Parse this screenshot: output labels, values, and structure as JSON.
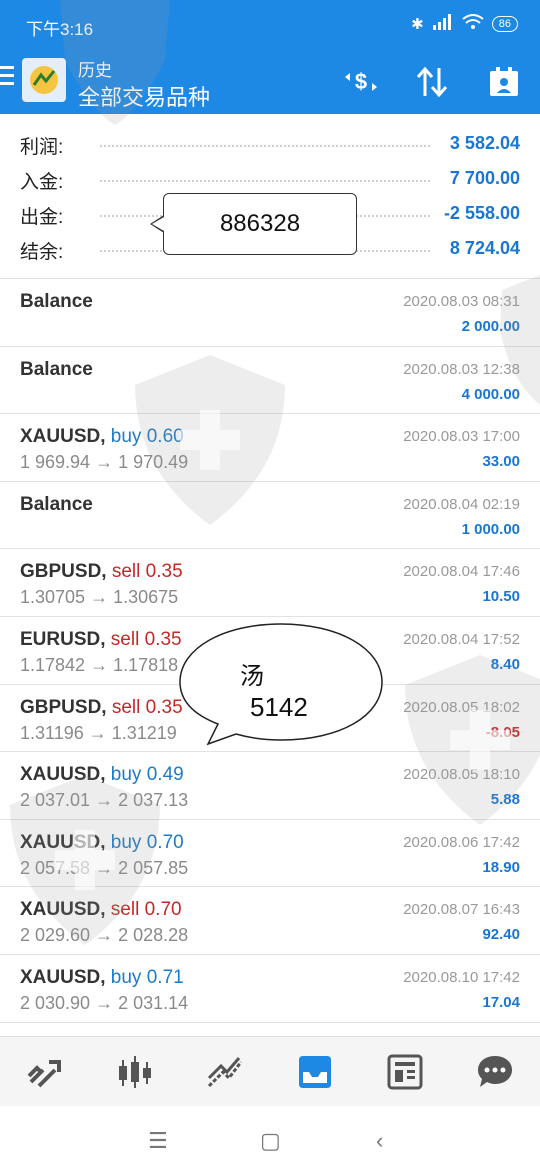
{
  "status": {
    "time": "下午3:16",
    "battery": "86"
  },
  "toolbar": {
    "subtitle": "历史",
    "title": "全部交易品种"
  },
  "summary": [
    {
      "label": "利润:",
      "value": "3 582.04"
    },
    {
      "label": "入金:",
      "value": "7 700.00"
    },
    {
      "label": "出金:",
      "value": "-2 558.00"
    },
    {
      "label": "结余:",
      "value": "8 724.04"
    }
  ],
  "annotations": {
    "bubble1": "886328",
    "bubble2_line1": "汤",
    "bubble2_line2": "5142"
  },
  "rows": [
    {
      "symbol": "Balance",
      "side": "",
      "volume": "",
      "prices": "",
      "date": "2020.08.03 08:31",
      "profit": "2 000.00",
      "negative": false
    },
    {
      "symbol": "Balance",
      "side": "",
      "volume": "",
      "prices": "",
      "date": "2020.08.03 12:38",
      "profit": "4 000.00",
      "negative": false
    },
    {
      "symbol": "XAUUSD,",
      "side": "buy",
      "volume": "0.60",
      "prices": "1 969.94 → 1 970.49",
      "date": "2020.08.03 17:00",
      "profit": "33.00",
      "negative": false
    },
    {
      "symbol": "Balance",
      "side": "",
      "volume": "",
      "prices": "",
      "date": "2020.08.04 02:19",
      "profit": "1 000.00",
      "negative": false
    },
    {
      "symbol": "GBPUSD,",
      "side": "sell",
      "volume": "0.35",
      "prices": "1.30705 → 1.30675",
      "date": "2020.08.04 17:46",
      "profit": "10.50",
      "negative": false
    },
    {
      "symbol": "EURUSD,",
      "side": "sell",
      "volume": "0.35",
      "prices": "1.17842 → 1.17818",
      "date": "2020.08.04 17:52",
      "profit": "8.40",
      "negative": false
    },
    {
      "symbol": "GBPUSD,",
      "side": "sell",
      "volume": "0.35",
      "prices": "1.31196 → 1.31219",
      "date": "2020.08.05 18:02",
      "profit": "-8.05",
      "negative": true
    },
    {
      "symbol": "XAUUSD,",
      "side": "buy",
      "volume": "0.49",
      "prices": "2 037.01 → 2 037.13",
      "date": "2020.08.05 18:10",
      "profit": "5.88",
      "negative": false
    },
    {
      "symbol": "XAUUSD,",
      "side": "buy",
      "volume": "0.70",
      "prices": "2 057.58 → 2 057.85",
      "date": "2020.08.06 17:42",
      "profit": "18.90",
      "negative": false
    },
    {
      "symbol": "XAUUSD,",
      "side": "sell",
      "volume": "0.70",
      "prices": "2 029.60 → 2 028.28",
      "date": "2020.08.07 16:43",
      "profit": "92.40",
      "negative": false
    },
    {
      "symbol": "XAUUSD,",
      "side": "buy",
      "volume": "0.71",
      "prices": "2 030.90 → 2 031.14",
      "date": "2020.08.10 17:42",
      "profit": "17.04",
      "negative": false
    }
  ],
  "bottom_nav": [
    "quotes-icon",
    "chart-icon",
    "trade-icon",
    "history-icon",
    "news-icon",
    "chat-icon"
  ],
  "colors": {
    "header": "#1e88e5",
    "positive": "#1976d2",
    "negative": "#c62828",
    "buy": "#1e7bc6"
  }
}
